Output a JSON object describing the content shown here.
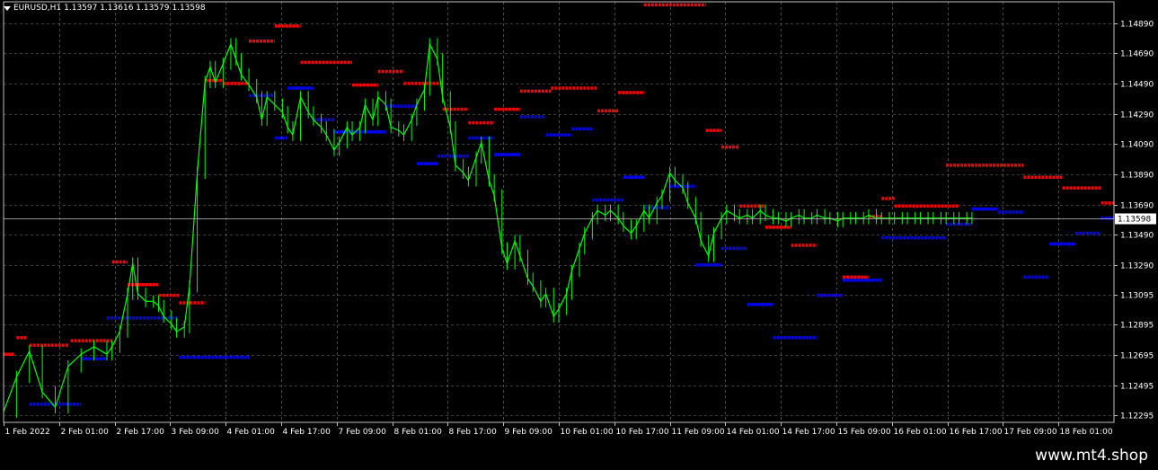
{
  "header": {
    "symbol": "EURUSD,H1",
    "quotes": "1.13597 1.13616 1.13579 1.13598"
  },
  "watermark": "www.mt4.shop",
  "colors": {
    "background": "#000000",
    "grid": "#c0c0c0",
    "price_line": "#00ff00",
    "resistance": "#ff0000",
    "support": "#0000ff",
    "current_price_box": "#c0c0c0"
  },
  "chart_data": {
    "type": "line",
    "title": "",
    "xlabel": "",
    "ylabel": "",
    "ylim": [
      1.1225,
      1.1503
    ],
    "grid": true,
    "y_ticks": [
      "1.14890",
      "1.14690",
      "1.14490",
      "1.14290",
      "1.14090",
      "1.13890",
      "1.13690",
      "1.13490",
      "1.13290",
      "1.13095",
      "1.12895",
      "1.12695",
      "1.12495",
      "1.12295"
    ],
    "x_ticks": [
      "1 Feb 2022",
      "2 Feb 01:00",
      "2 Feb 17:00",
      "3 Feb 09:00",
      "4 Feb 01:00",
      "4 Feb 17:00",
      "7 Feb 09:00",
      "8 Feb 01:00",
      "8 Feb 17:00",
      "9 Feb 09:00",
      "10 Feb 01:00",
      "10 Feb 17:00",
      "11 Feb 09:00",
      "14 Feb 01:00",
      "14 Feb 17:00",
      "15 Feb 09:00",
      "16 Feb 01:00",
      "16 Feb 17:00",
      "17 Feb 09:00",
      "18 Feb 01:00"
    ],
    "current_price": "1.13598",
    "series": [
      {
        "x_bar": [
          0,
          5,
          10,
          15,
          20,
          25,
          30,
          35,
          40,
          42,
          45,
          48,
          50,
          52,
          55,
          58,
          60,
          62,
          65,
          67,
          70,
          72,
          75,
          78,
          80,
          82,
          85,
          88,
          90,
          92,
          95,
          98,
          100,
          102,
          105,
          108,
          110,
          112,
          115,
          118,
          120,
          123,
          125,
          128,
          130,
          133,
          135,
          138,
          140,
          143,
          145,
          148,
          150,
          153,
          155,
          158,
          160,
          163,
          165,
          168,
          170,
          173,
          175,
          178,
          180,
          183,
          185,
          188,
          190,
          193,
          195,
          198,
          200,
          203,
          205,
          208,
          210,
          213,
          215,
          218,
          220,
          223,
          225,
          228,
          230,
          233,
          235,
          238,
          240,
          243,
          245,
          248,
          250,
          253,
          255,
          258,
          260,
          263,
          265,
          268,
          270,
          273,
          275,
          278,
          280,
          283,
          285,
          288,
          290,
          293,
          295,
          298,
          300,
          303,
          305,
          308,
          310,
          313,
          315,
          318,
          320,
          323,
          325,
          328,
          330,
          333,
          335,
          338,
          340,
          343,
          345,
          348,
          350,
          353,
          355,
          358,
          360,
          363,
          365,
          368,
          370,
          373,
          375,
          378,
          380
        ],
        "values": [
          1.1232,
          1.1255,
          1.1272,
          1.1245,
          1.1235,
          1.1262,
          1.127,
          1.1275,
          1.127,
          1.1275,
          1.1285,
          1.131,
          1.133,
          1.131,
          1.1305,
          1.1305,
          1.1302,
          1.1295,
          1.129,
          1.1285,
          1.1288,
          1.1315,
          1.139,
          1.145,
          1.146,
          1.145,
          1.1462,
          1.1475,
          1.1465,
          1.1455,
          1.1448,
          1.144,
          1.1425,
          1.144,
          1.1435,
          1.143,
          1.142,
          1.1415,
          1.144,
          1.143,
          1.1425,
          1.142,
          1.1415,
          1.1405,
          1.141,
          1.142,
          1.1415,
          1.142,
          1.1435,
          1.1425,
          1.144,
          1.1435,
          1.142,
          1.1418,
          1.1415,
          1.1425,
          1.1435,
          1.1445,
          1.1475,
          1.1465,
          1.144,
          1.142,
          1.1395,
          1.139,
          1.1385,
          1.14,
          1.141,
          1.1385,
          1.1375,
          1.134,
          1.133,
          1.1345,
          1.1335,
          1.132,
          1.1315,
          1.1305,
          1.131,
          1.1295,
          1.13,
          1.131,
          1.1325,
          1.134,
          1.135,
          1.136,
          1.1365,
          1.1362,
          1.1365,
          1.136,
          1.1355,
          1.135,
          1.1355,
          1.1365,
          1.136,
          1.137,
          1.1375,
          1.139,
          1.1385,
          1.138,
          1.137,
          1.136,
          1.1345,
          1.1335,
          1.135,
          1.136,
          1.1365,
          1.1362,
          1.136,
          1.1362,
          1.136,
          1.1365,
          1.1362,
          1.136,
          1.136,
          1.1358,
          1.136,
          1.1362,
          1.136,
          1.136,
          1.1362,
          1.136,
          1.136,
          1.1358,
          1.136,
          1.136,
          1.136,
          1.136,
          1.1362,
          1.136,
          1.136,
          1.136,
          1.136,
          1.136,
          1.136,
          1.136,
          1.136,
          1.136,
          1.136,
          1.136,
          1.136,
          1.136,
          1.136,
          1.136,
          1.136
        ]
      }
    ],
    "resistance_levels": [
      {
        "x0": 0,
        "x1": 4,
        "y": 1.127
      },
      {
        "x0": 5,
        "x1": 9,
        "y": 1.1281
      },
      {
        "x0": 10,
        "x1": 25,
        "y": 1.1276
      },
      {
        "x0": 26,
        "x1": 42,
        "y": 1.1279
      },
      {
        "x0": 42,
        "x1": 48,
        "y": 1.1331
      },
      {
        "x0": 48,
        "x1": 60,
        "y": 1.1316
      },
      {
        "x0": 60,
        "x1": 68,
        "y": 1.1309
      },
      {
        "x0": 68,
        "x1": 78,
        "y": 1.1304
      },
      {
        "x0": 78,
        "x1": 85,
        "y": 1.1451
      },
      {
        "x0": 85,
        "x1": 95,
        "y": 1.1449
      },
      {
        "x0": 95,
        "x1": 105,
        "y": 1.1477
      },
      {
        "x0": 105,
        "x1": 115,
        "y": 1.1487
      },
      {
        "x0": 115,
        "x1": 135,
        "y": 1.1463
      },
      {
        "x0": 135,
        "x1": 145,
        "y": 1.1448
      },
      {
        "x0": 145,
        "x1": 155,
        "y": 1.1457
      },
      {
        "x0": 155,
        "x1": 170,
        "y": 1.1449
      },
      {
        "x0": 170,
        "x1": 180,
        "y": 1.1432
      },
      {
        "x0": 180,
        "x1": 190,
        "y": 1.1423
      },
      {
        "x0": 190,
        "x1": 200,
        "y": 1.1432
      },
      {
        "x0": 200,
        "x1": 212,
        "y": 1.1444
      },
      {
        "x0": 212,
        "x1": 230,
        "y": 1.1446
      },
      {
        "x0": 230,
        "x1": 238,
        "y": 1.1431
      },
      {
        "x0": 238,
        "x1": 248,
        "y": 1.1443
      },
      {
        "x0": 248,
        "x1": 272,
        "y": 1.1501
      },
      {
        "x0": 272,
        "x1": 278,
        "y": 1.1418
      },
      {
        "x0": 278,
        "x1": 285,
        "y": 1.1407
      },
      {
        "x0": 285,
        "x1": 295,
        "y": 1.1368
      },
      {
        "x0": 295,
        "x1": 305,
        "y": 1.1354
      },
      {
        "x0": 305,
        "x1": 315,
        "y": 1.1342
      },
      {
        "x0": 315,
        "x1": 325,
        "y": 1.1309
      },
      {
        "x0": 325,
        "x1": 335,
        "y": 1.1321
      },
      {
        "x0": 335,
        "x1": 340,
        "y": 1.1361
      },
      {
        "x0": 340,
        "x1": 345,
        "y": 1.1373
      },
      {
        "x0": 345,
        "x1": 370,
        "y": 1.1368
      },
      {
        "x0": 365,
        "x1": 395,
        "y": 1.1395
      },
      {
        "x0": 395,
        "x1": 410,
        "y": 1.1387
      },
      {
        "x0": 410,
        "x1": 425,
        "y": 1.138
      },
      {
        "x0": 425,
        "x1": 430,
        "y": 1.137
      }
    ],
    "support_levels": [
      {
        "x0": 10,
        "x1": 30,
        "y": 1.1237
      },
      {
        "x0": 30,
        "x1": 40,
        "y": 1.1267
      },
      {
        "x0": 40,
        "x1": 68,
        "y": 1.1294
      },
      {
        "x0": 68,
        "x1": 95,
        "y": 1.1268
      },
      {
        "x0": 95,
        "x1": 105,
        "y": 1.1441
      },
      {
        "x0": 105,
        "x1": 110,
        "y": 1.1413
      },
      {
        "x0": 110,
        "x1": 120,
        "y": 1.1446
      },
      {
        "x0": 120,
        "x1": 128,
        "y": 1.1425
      },
      {
        "x0": 128,
        "x1": 148,
        "y": 1.1417
      },
      {
        "x0": 148,
        "x1": 160,
        "y": 1.1434
      },
      {
        "x0": 160,
        "x1": 168,
        "y": 1.1396
      },
      {
        "x0": 168,
        "x1": 180,
        "y": 1.1401
      },
      {
        "x0": 180,
        "x1": 190,
        "y": 1.1413
      },
      {
        "x0": 190,
        "x1": 200,
        "y": 1.1402
      },
      {
        "x0": 200,
        "x1": 210,
        "y": 1.1427
      },
      {
        "x0": 210,
        "x1": 220,
        "y": 1.1415
      },
      {
        "x0": 220,
        "x1": 228,
        "y": 1.1419
      },
      {
        "x0": 228,
        "x1": 240,
        "y": 1.1372
      },
      {
        "x0": 240,
        "x1": 248,
        "y": 1.1387
      },
      {
        "x0": 248,
        "x1": 258,
        "y": 1.1367
      },
      {
        "x0": 258,
        "x1": 268,
        "y": 1.1381
      },
      {
        "x0": 268,
        "x1": 278,
        "y": 1.1329
      },
      {
        "x0": 278,
        "x1": 288,
        "y": 1.134
      },
      {
        "x0": 288,
        "x1": 298,
        "y": 1.1303
      },
      {
        "x0": 298,
        "x1": 315,
        "y": 1.1281
      },
      {
        "x0": 315,
        "x1": 325,
        "y": 1.1309
      },
      {
        "x0": 325,
        "x1": 340,
        "y": 1.1319
      },
      {
        "x0": 340,
        "x1": 365,
        "y": 1.1347
      },
      {
        "x0": 365,
        "x1": 375,
        "y": 1.1356
      },
      {
        "x0": 375,
        "x1": 385,
        "y": 1.1366
      },
      {
        "x0": 385,
        "x1": 395,
        "y": 1.1364
      },
      {
        "x0": 395,
        "x1": 405,
        "y": 1.1321
      },
      {
        "x0": 405,
        "x1": 415,
        "y": 1.1343
      },
      {
        "x0": 415,
        "x1": 425,
        "y": 1.135
      },
      {
        "x0": 425,
        "x1": 430,
        "y": 1.136
      }
    ]
  }
}
